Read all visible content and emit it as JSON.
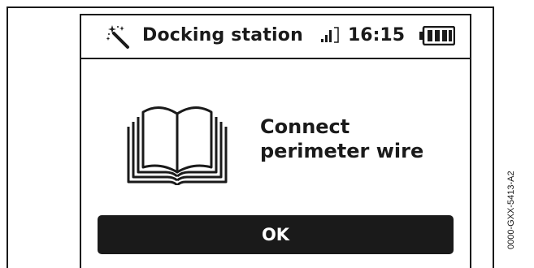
{
  "status_bar": {
    "title": "Docking station",
    "time": "16:15",
    "title_icon": "magic-wand-icon",
    "signal_icon": "signal-strength-icon",
    "battery_icon": "battery-icon"
  },
  "main": {
    "illustration_icon": "open-book-icon",
    "message_line1": "Connect",
    "message_line2": "perimeter wire"
  },
  "footer": {
    "ok_label": "OK"
  },
  "figure_id": "0000-GXX-5413-A2",
  "colors": {
    "foreground": "#1a1a1a",
    "background": "#ffffff"
  }
}
